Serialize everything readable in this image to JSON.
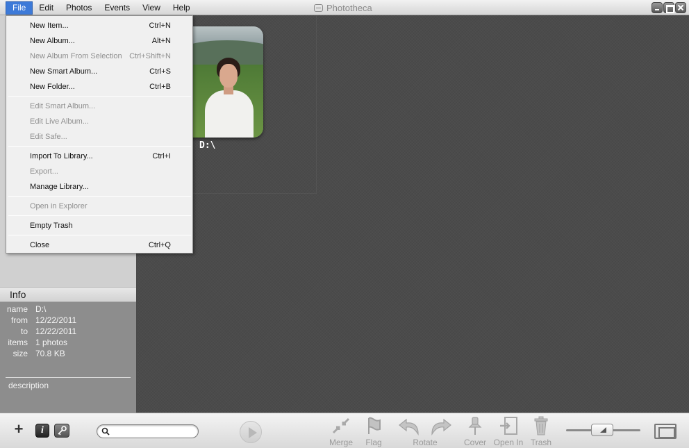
{
  "app": {
    "title": "Phototheca"
  },
  "menubar": {
    "items": [
      "File",
      "Edit",
      "Photos",
      "Events",
      "View",
      "Help"
    ],
    "active": "File"
  },
  "file_menu": {
    "items": [
      {
        "label": "New Item...",
        "shortcut": "Ctrl+N",
        "enabled": true
      },
      {
        "label": "New Album...",
        "shortcut": "Alt+N",
        "enabled": true
      },
      {
        "label": "New Album From Selection",
        "shortcut": "Ctrl+Shift+N",
        "enabled": false
      },
      {
        "label": "New Smart Album...",
        "shortcut": "Ctrl+S",
        "enabled": true
      },
      {
        "label": "New Folder...",
        "shortcut": "Ctrl+B",
        "enabled": true
      },
      {
        "label": "Edit Smart Album...",
        "shortcut": "",
        "enabled": false
      },
      {
        "label": "Edit Live Album...",
        "shortcut": "",
        "enabled": false
      },
      {
        "label": "Edit Safe...",
        "shortcut": "",
        "enabled": false
      },
      {
        "label": "Import To Library...",
        "shortcut": "Ctrl+I",
        "enabled": true
      },
      {
        "label": "Export...",
        "shortcut": "",
        "enabled": false
      },
      {
        "label": "Manage Library...",
        "shortcut": "",
        "enabled": true
      },
      {
        "label": "Open in Explorer",
        "shortcut": "",
        "enabled": false
      },
      {
        "label": "Empty Trash",
        "shortcut": "",
        "enabled": true
      },
      {
        "label": "Close",
        "shortcut": "Ctrl+Q",
        "enabled": true
      }
    ]
  },
  "album": {
    "label": "D:\\"
  },
  "info": {
    "header": "Info",
    "fields": [
      {
        "key": "name",
        "value": "D:\\"
      },
      {
        "key": "from",
        "value": "12/22/2011"
      },
      {
        "key": "to",
        "value": "12/22/2011"
      },
      {
        "key": "items",
        "value": "1 photos"
      },
      {
        "key": "size",
        "value": "70.8 KB"
      }
    ],
    "description_placeholder": "description"
  },
  "toolbar": {
    "add_label": "+",
    "info_label": "i",
    "search_value": "",
    "tools": [
      "Merge",
      "Flag",
      "Rotate",
      "Cover",
      "Open In",
      "Trash"
    ]
  }
}
